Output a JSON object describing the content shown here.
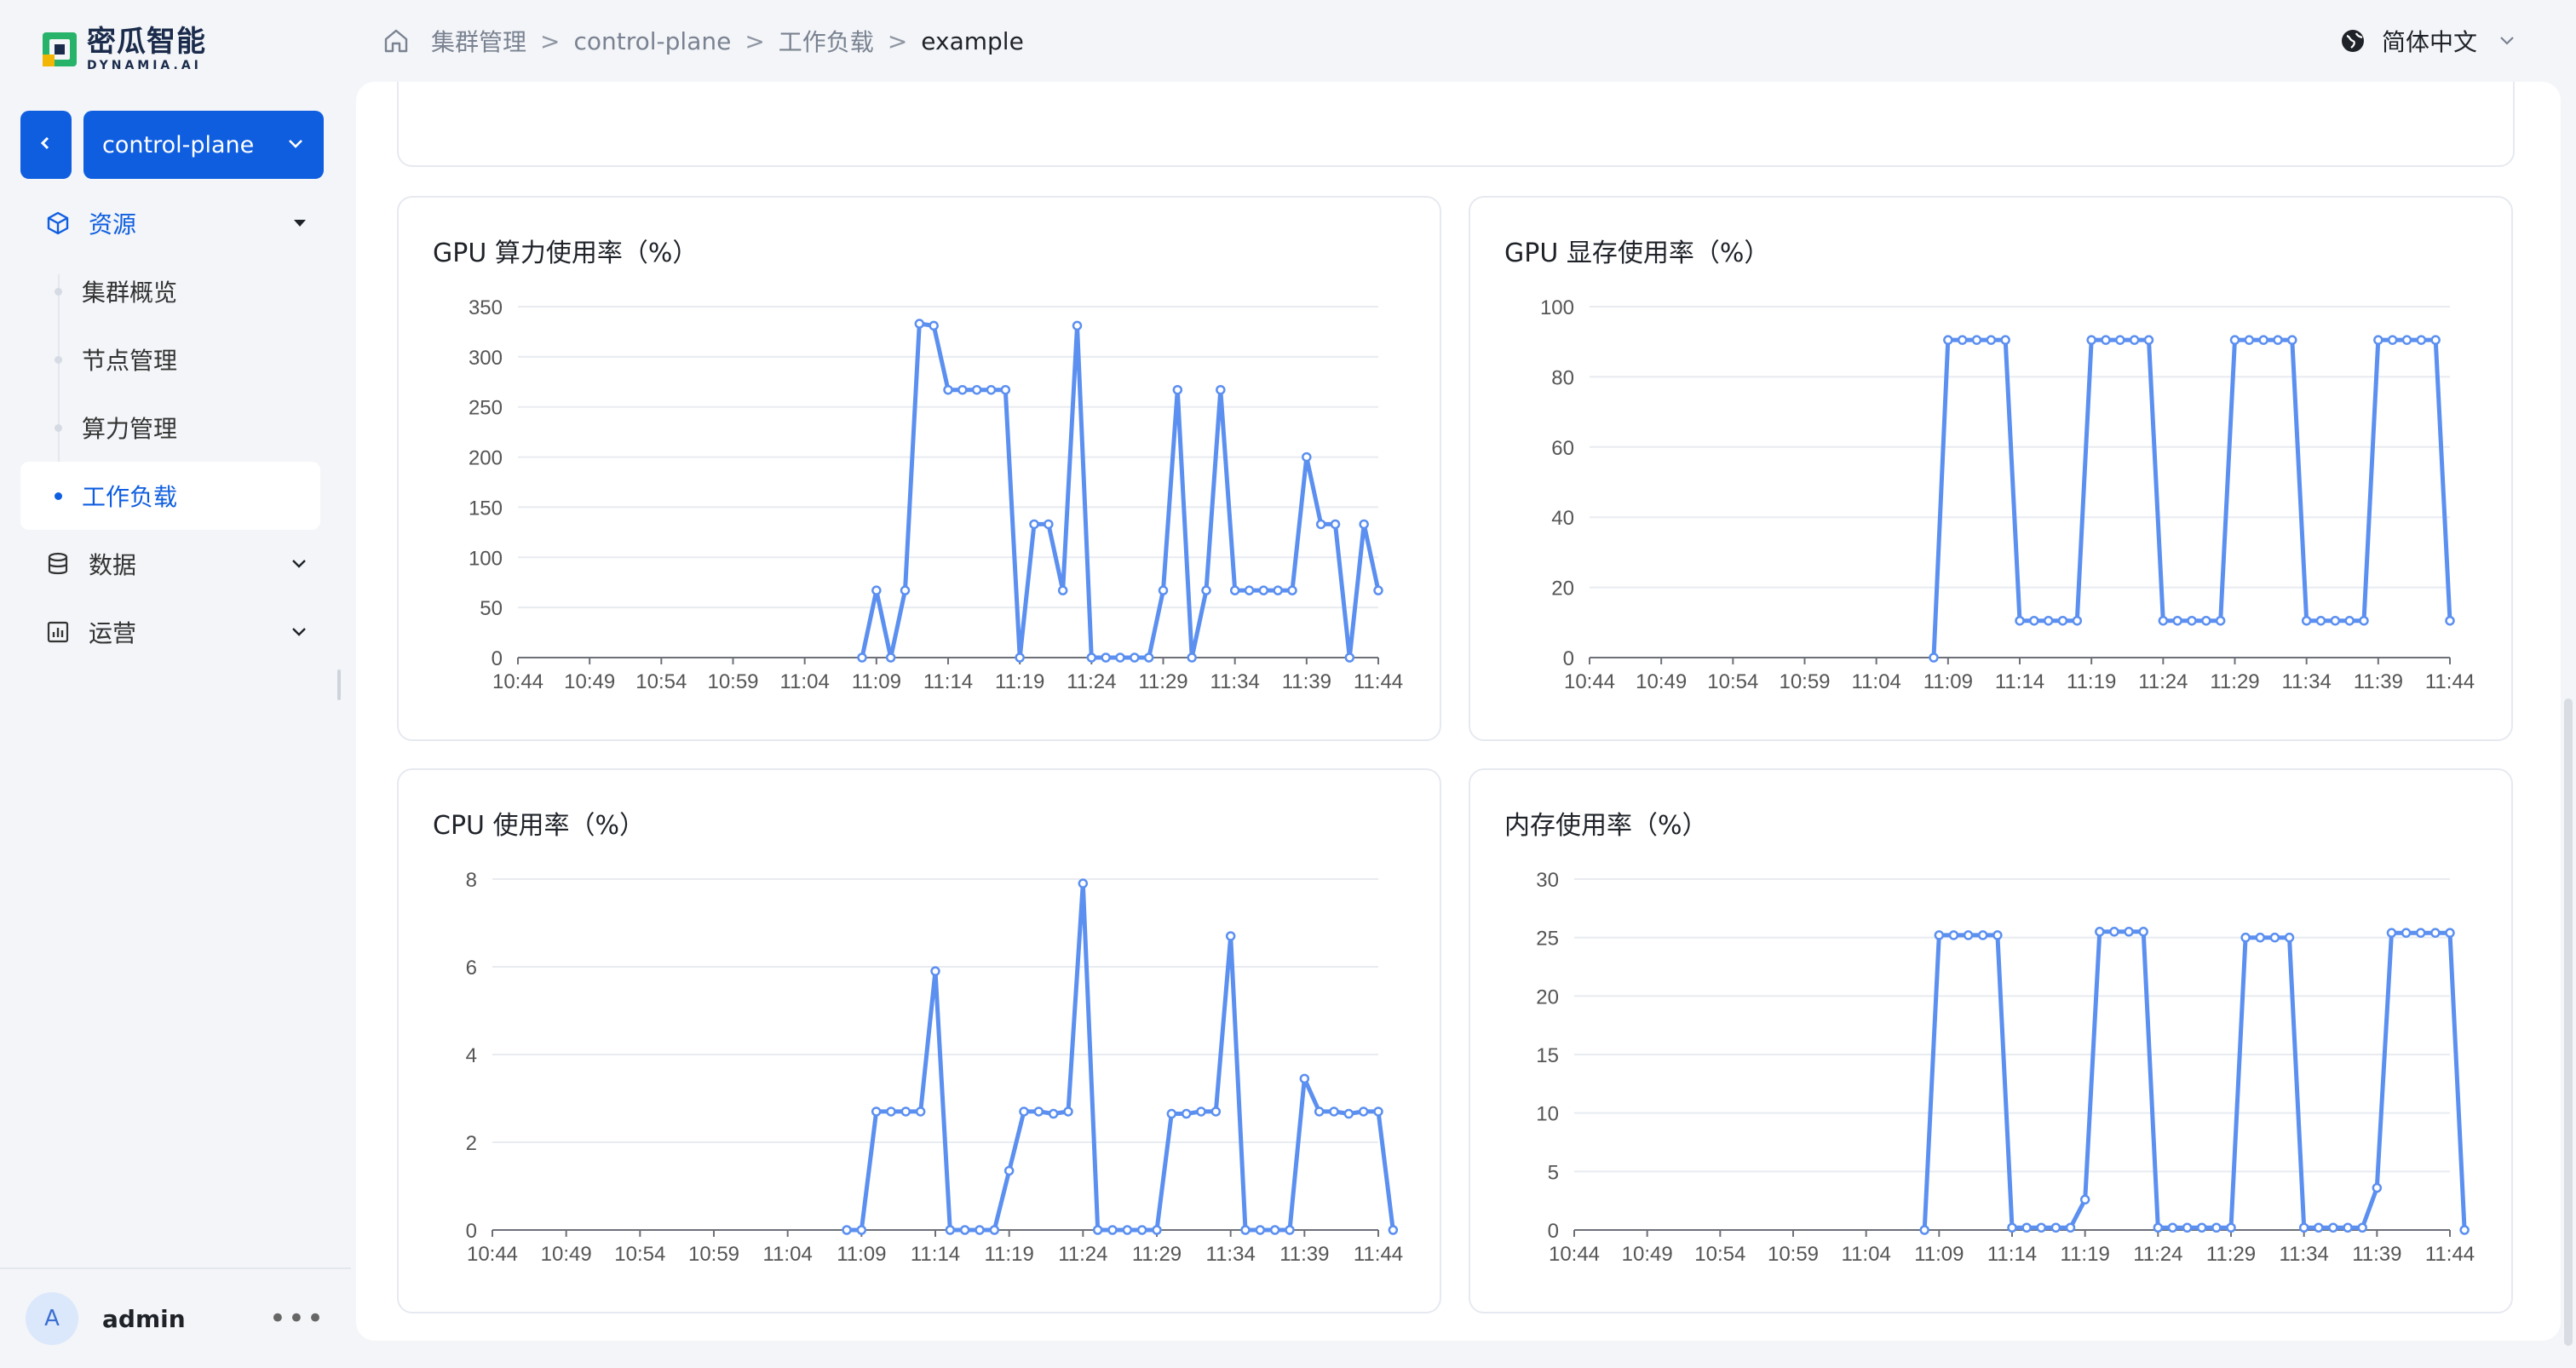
{
  "brand": {
    "name_cn": "密瓜智能",
    "name_en": "DYNAMIA.AI",
    "colors": {
      "accent": "#0f5ee0",
      "series": "#5b8ff0"
    }
  },
  "cluster_selector": {
    "value": "control-plane"
  },
  "sidebar": {
    "groups": [
      {
        "label": "资源",
        "icon": "cube-icon",
        "expanded": true,
        "items": [
          {
            "label": "集群概览"
          },
          {
            "label": "节点管理"
          },
          {
            "label": "算力管理"
          },
          {
            "label": "工作负载",
            "active": true
          }
        ]
      },
      {
        "label": "数据",
        "icon": "database-icon",
        "expanded": false
      },
      {
        "label": "运营",
        "icon": "bar-chart-icon",
        "expanded": false
      }
    ]
  },
  "user": {
    "initial": "A",
    "name": "admin"
  },
  "breadcrumb": {
    "items": [
      "集群管理",
      "control-plane",
      "工作负载"
    ],
    "current": "example",
    "separator": ">"
  },
  "language": {
    "label": "简体中文"
  },
  "x_ticks": [
    "10:44",
    "10:49",
    "10:54",
    "10:59",
    "11:04",
    "11:09",
    "11:14",
    "11:19",
    "11:24",
    "11:29",
    "11:34",
    "11:39",
    "11:44"
  ],
  "chart_data": [
    {
      "type": "line",
      "title": "GPU 算力使用率（%）",
      "ylim": [
        0,
        350
      ],
      "yticks": [
        0,
        50,
        100,
        150,
        200,
        250,
        300,
        350
      ],
      "series": [
        {
          "values": [
            [
              24,
              0
            ],
            [
              25,
              67
            ],
            [
              26,
              0
            ],
            [
              27,
              67
            ],
            [
              28,
              333
            ],
            [
              29,
              331
            ],
            [
              30,
              267
            ],
            [
              31,
              267
            ],
            [
              32,
              267
            ],
            [
              33,
              267
            ],
            [
              34,
              267
            ],
            [
              35,
              0
            ],
            [
              36,
              133
            ],
            [
              37,
              133
            ],
            [
              38,
              67
            ],
            [
              39,
              331
            ],
            [
              40,
              0
            ],
            [
              41,
              0
            ],
            [
              42,
              0
            ],
            [
              43,
              0
            ],
            [
              44,
              0
            ],
            [
              45,
              67
            ],
            [
              46,
              267
            ],
            [
              47,
              0
            ],
            [
              48,
              67
            ],
            [
              49,
              267
            ],
            [
              50,
              67
            ],
            [
              51,
              67
            ],
            [
              52,
              67
            ],
            [
              53,
              67
            ],
            [
              54,
              67
            ],
            [
              55,
              200
            ],
            [
              56,
              133
            ],
            [
              57,
              133
            ],
            [
              58,
              0
            ],
            [
              59,
              133
            ],
            [
              60,
              67
            ]
          ]
        }
      ]
    },
    {
      "type": "line",
      "title": "GPU 显存使用率（%）",
      "ylim": [
        0,
        100
      ],
      "yticks": [
        0,
        20,
        40,
        60,
        80,
        100
      ],
      "series": [
        {
          "values": [
            [
              24,
              0
            ],
            [
              25,
              90.5
            ],
            [
              26,
              90.5
            ],
            [
              27,
              90.5
            ],
            [
              28,
              90.5
            ],
            [
              29,
              90.5
            ],
            [
              30,
              10.5
            ],
            [
              31,
              10.5
            ],
            [
              32,
              10.5
            ],
            [
              33,
              10.5
            ],
            [
              34,
              10.5
            ],
            [
              35,
              90.5
            ],
            [
              36,
              90.5
            ],
            [
              37,
              90.5
            ],
            [
              38,
              90.5
            ],
            [
              39,
              90.5
            ],
            [
              40,
              10.5
            ],
            [
              41,
              10.5
            ],
            [
              42,
              10.5
            ],
            [
              43,
              10.5
            ],
            [
              44,
              10.5
            ],
            [
              45,
              90.5
            ],
            [
              46,
              90.5
            ],
            [
              47,
              90.5
            ],
            [
              48,
              90.5
            ],
            [
              49,
              90.5
            ],
            [
              50,
              10.5
            ],
            [
              51,
              10.5
            ],
            [
              52,
              10.5
            ],
            [
              53,
              10.5
            ],
            [
              54,
              10.5
            ],
            [
              55,
              90.5
            ],
            [
              56,
              90.5
            ],
            [
              57,
              90.5
            ],
            [
              58,
              90.5
            ],
            [
              59,
              90.5
            ],
            [
              60,
              10.5
            ]
          ]
        }
      ]
    },
    {
      "type": "line",
      "title": "CPU 使用率（%）",
      "ylim": [
        0,
        8
      ],
      "yticks": [
        0,
        2,
        4,
        6,
        8
      ],
      "series": [
        {
          "values": [
            [
              24,
              0
            ],
            [
              25,
              0
            ],
            [
              26,
              2.7
            ],
            [
              27,
              2.7
            ],
            [
              28,
              2.7
            ],
            [
              29,
              2.7
            ],
            [
              30,
              5.9
            ],
            [
              31,
              0
            ],
            [
              32,
              0
            ],
            [
              33,
              0
            ],
            [
              34,
              0
            ],
            [
              35,
              1.35
            ],
            [
              36,
              2.7
            ],
            [
              37,
              2.7
            ],
            [
              38,
              2.65
            ],
            [
              39,
              2.7
            ],
            [
              40,
              7.9
            ],
            [
              41,
              0
            ],
            [
              42,
              0
            ],
            [
              43,
              0
            ],
            [
              44,
              0
            ],
            [
              45,
              0
            ],
            [
              46,
              2.65
            ],
            [
              47,
              2.65
            ],
            [
              48,
              2.7
            ],
            [
              49,
              2.7
            ],
            [
              50,
              6.7
            ],
            [
              51,
              0
            ],
            [
              52,
              0
            ],
            [
              53,
              0
            ],
            [
              54,
              0
            ],
            [
              55,
              3.45
            ],
            [
              56,
              2.7
            ],
            [
              57,
              2.7
            ],
            [
              58,
              2.65
            ],
            [
              59,
              2.7
            ],
            [
              60,
              2.7
            ],
            [
              61,
              0
            ]
          ]
        }
      ]
    },
    {
      "type": "line",
      "title": "内存使用率（%）",
      "ylim": [
        0,
        30
      ],
      "yticks": [
        0,
        5,
        10,
        15,
        20,
        25,
        30
      ],
      "series": [
        {
          "values": [
            [
              24,
              0
            ],
            [
              25,
              25.2
            ],
            [
              26,
              25.2
            ],
            [
              27,
              25.2
            ],
            [
              28,
              25.2
            ],
            [
              29,
              25.2
            ],
            [
              30,
              0.2
            ],
            [
              31,
              0.2
            ],
            [
              32,
              0.2
            ],
            [
              33,
              0.2
            ],
            [
              34,
              0.2
            ],
            [
              35,
              2.6
            ],
            [
              36,
              25.5
            ],
            [
              37,
              25.5
            ],
            [
              38,
              25.5
            ],
            [
              39,
              25.5
            ],
            [
              40,
              0.2
            ],
            [
              41,
              0.2
            ],
            [
              42,
              0.2
            ],
            [
              43,
              0.2
            ],
            [
              44,
              0.2
            ],
            [
              45,
              0.2
            ],
            [
              46,
              25
            ],
            [
              47,
              25
            ],
            [
              48,
              25
            ],
            [
              49,
              25
            ],
            [
              50,
              0.2
            ],
            [
              51,
              0.2
            ],
            [
              52,
              0.2
            ],
            [
              53,
              0.2
            ],
            [
              54,
              0.2
            ],
            [
              55,
              3.6
            ],
            [
              56,
              25.4
            ],
            [
              57,
              25.4
            ],
            [
              58,
              25.4
            ],
            [
              59,
              25.4
            ],
            [
              60,
              25.4
            ],
            [
              61,
              0
            ]
          ]
        }
      ]
    }
  ]
}
